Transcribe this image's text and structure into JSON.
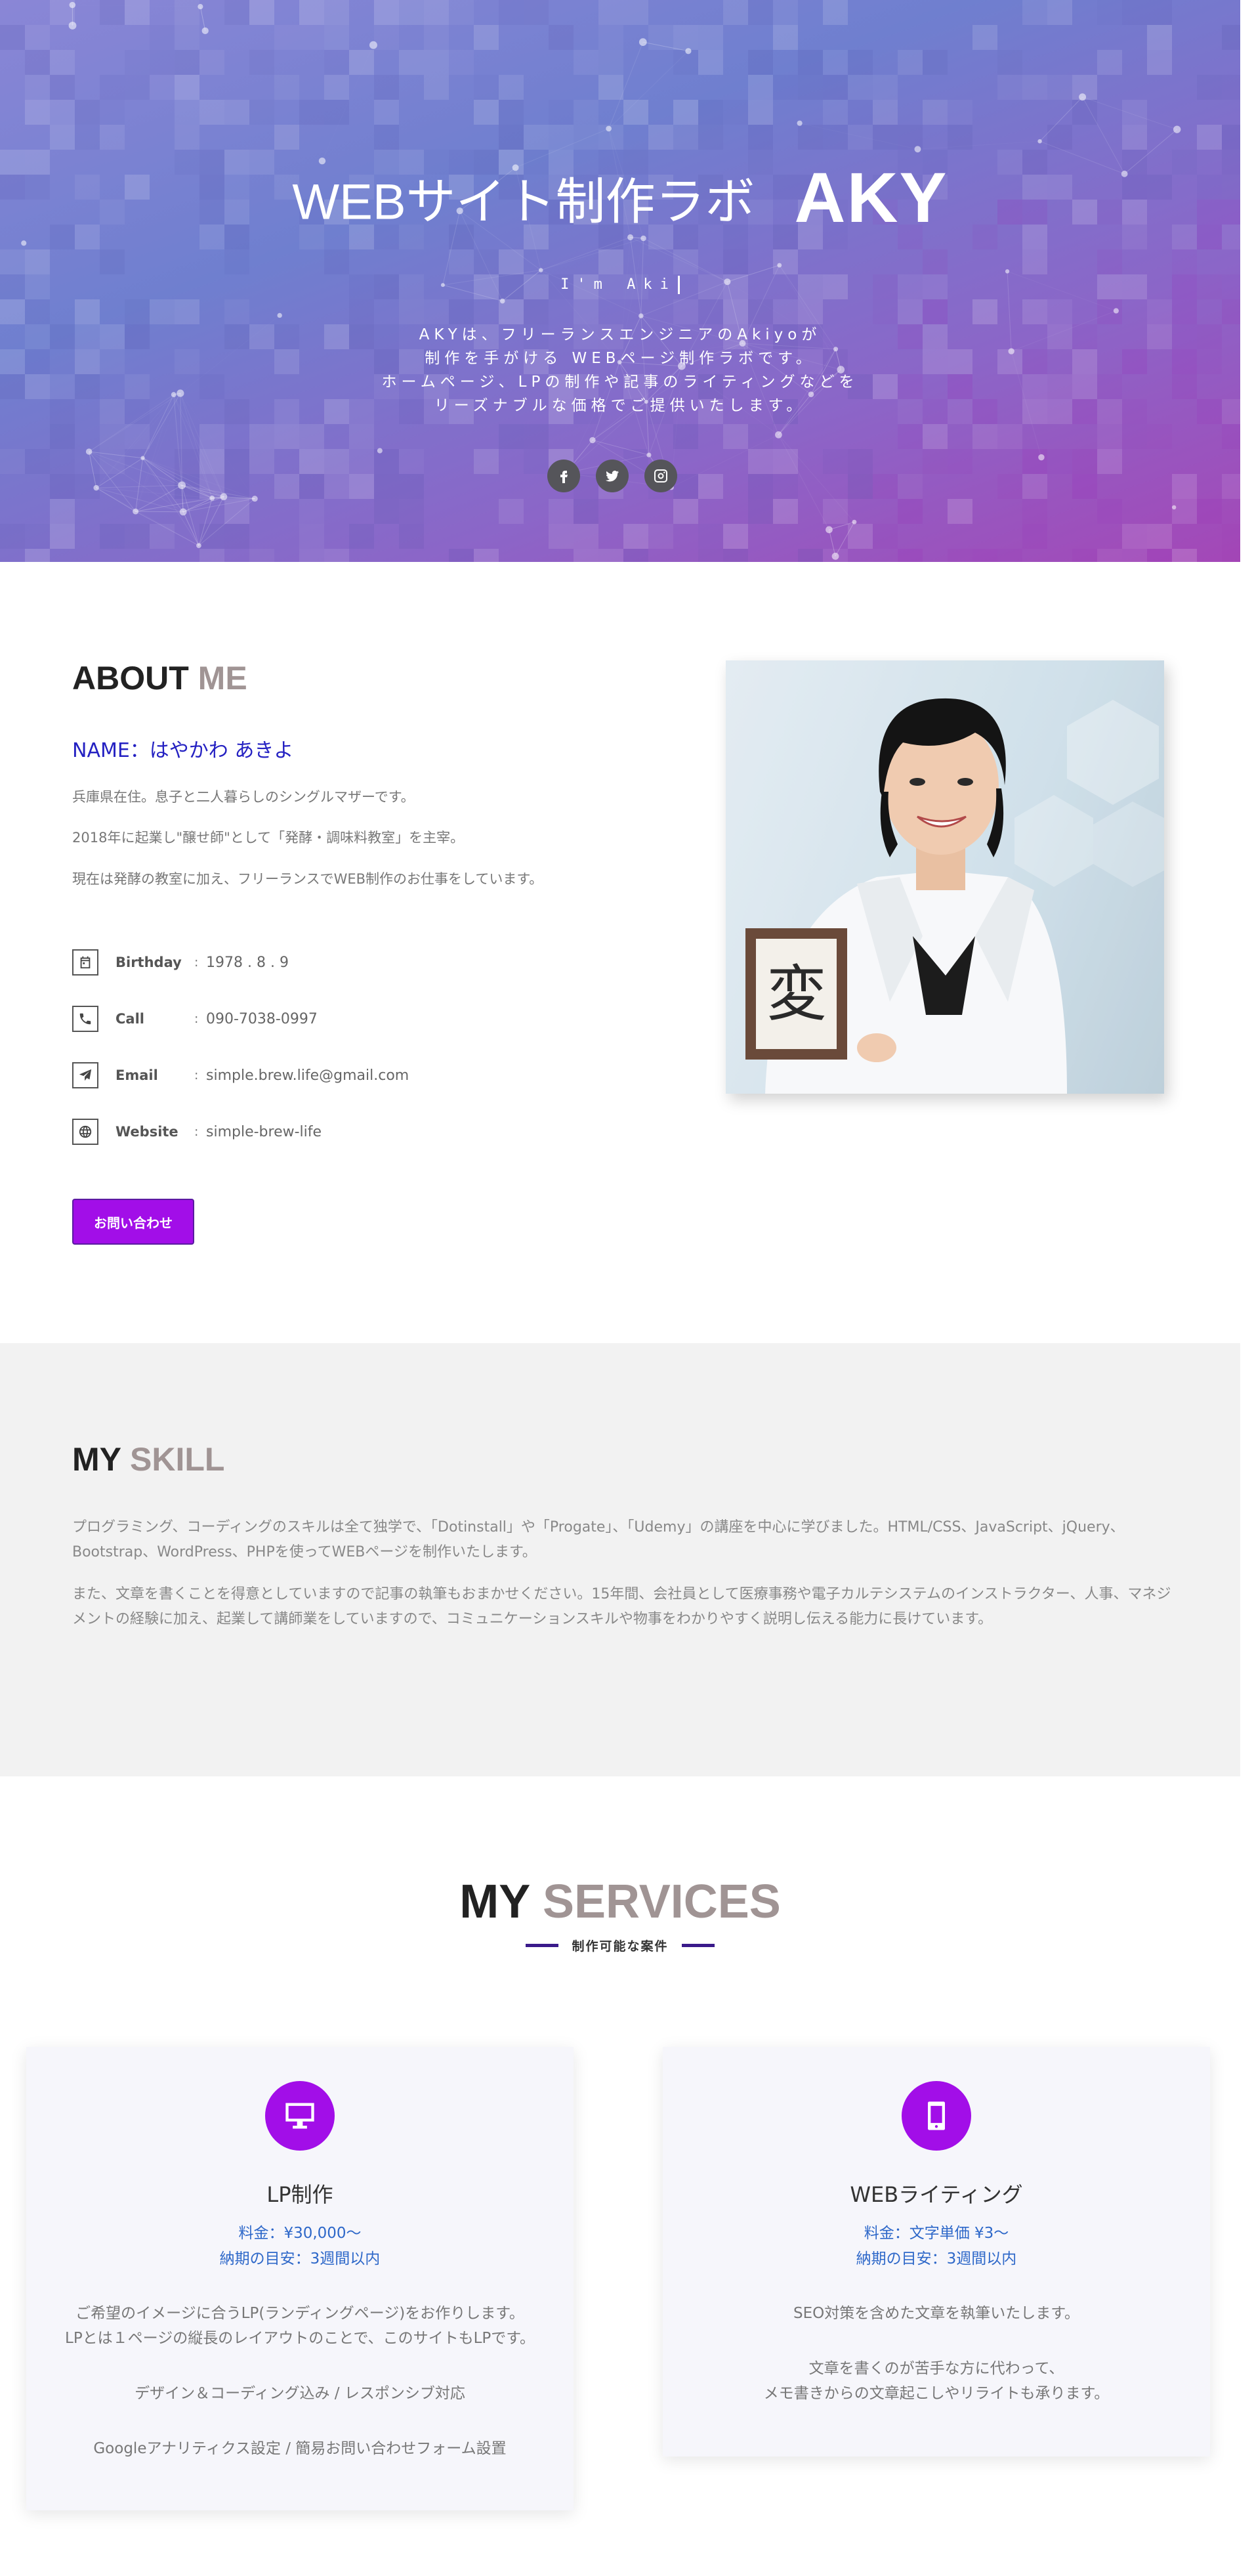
{
  "hero": {
    "title_main": "WEBサイト制作ラボ",
    "title_brand": "AKY",
    "subtitle": "I'm Aki",
    "description": [
      "AKYは、フリーランスエンジニアのAkiyoが",
      "制作を手がける WEBページ制作ラボです。",
      "ホームページ、LPの制作や記事のライティングなどを",
      "リーズナブルな価格でご提供いたします。"
    ],
    "social": [
      "facebook-icon",
      "twitter-icon",
      "instagram-icon"
    ]
  },
  "about": {
    "heading_a": "ABOUT",
    "heading_b": "ME",
    "name": "NAME：はやかわ あきよ",
    "paragraphs": [
      "兵庫県在住。息子と二人暮らしのシングルマザーです。",
      "2018年に起業し\"醸せ師\"として「発酵・調味料教室」を主宰。",
      "現在は発酵の教室に加え、フリーランスでWEB制作のお仕事をしています。"
    ],
    "info": [
      {
        "label": "Birthday",
        "value": "1978 . 8 . 9",
        "icon": "calendar-icon"
      },
      {
        "label": "Call",
        "value": "090-7038-0997",
        "icon": "phone-icon"
      },
      {
        "label": "Email",
        "value": "simple.brew.life@gmail.com",
        "icon": "send-icon"
      },
      {
        "label": "Website",
        "value": "simple-brew-life",
        "icon": "globe-icon"
      }
    ],
    "button": "お問い合わせ",
    "photo_kanji": "変"
  },
  "skill": {
    "heading_a": "MY",
    "heading_b": "SKILL",
    "paragraphs": [
      "プログラミング、コーディングのスキルは全て独学で、「Dotinstall」や「Progate」、「Udemy」の講座を中心に学びました。HTML/CSS、JavaScript、jQuery、Bootstrap、WordPress、PHPを使ってWEBページを制作いたします。",
      "また、文章を書くことを得意としていますので記事の執筆もおまかせください。15年間、会社員として医療事務や電子カルテシステムのインストラクター、人事、マネジメントの経験に加え、起業して講師業をしていますので、コミュニケーションスキルや物事をわかりやすく説明し伝える能力に長けています。"
    ]
  },
  "services": {
    "heading_a": "MY",
    "heading_b": "SERVICES",
    "subheading": "制作可能な案件",
    "cards": [
      {
        "icon": "monitor-icon",
        "title": "LP制作",
        "price": "料金：¥30,000〜",
        "term": "納期の目安：3週間以内",
        "text": [
          "ご希望のイメージに合うLP(ランディングページ)をお作りします。",
          "LPとは１ページの縦長のレイアウトのことで、このサイトもLPです。",
          "デザイン＆コーディング込み / レスポンシブ対応",
          "Googleアナリティクス設定 / 簡易お問い合わせフォーム設置"
        ]
      },
      {
        "icon": "smartphone-icon",
        "title": "WEBライティング",
        "price": "料金：文字単価 ¥3〜",
        "term": "納期の目安：3週間以内",
        "text": [
          "SEO対策を含めた文章を執筆いたします。",
          "文章を書くのが苦手な方に代わって、",
          "メモ書きからの文章起こしやリライトも承ります。"
        ]
      }
    ]
  }
}
